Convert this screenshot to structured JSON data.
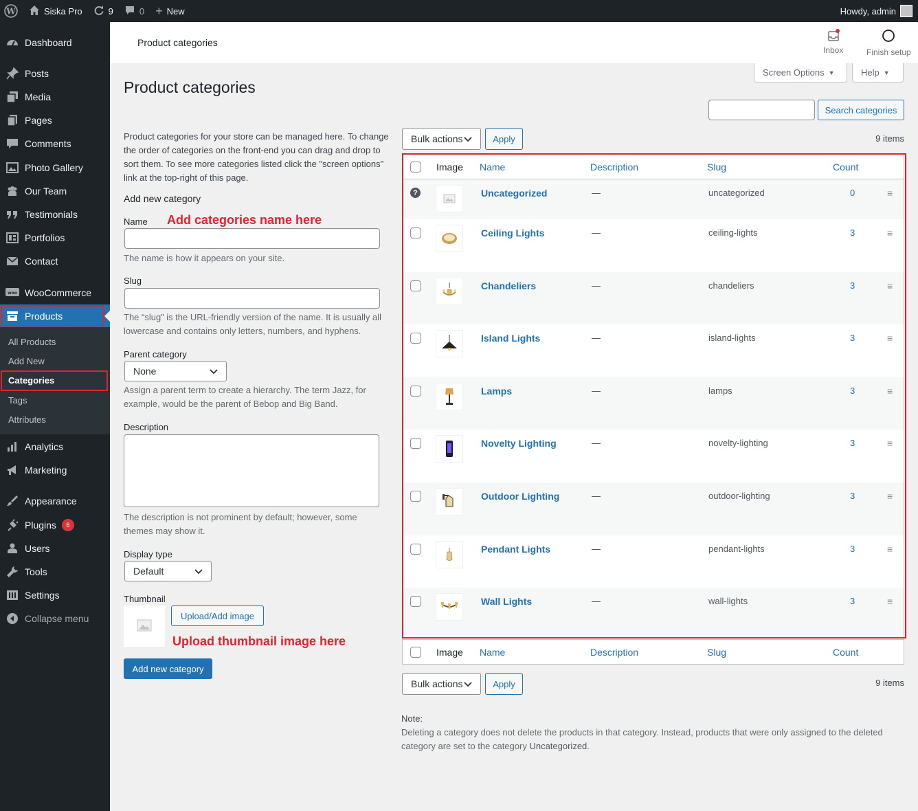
{
  "adminbar": {
    "site_name": "Siska Pro",
    "updates_count": "9",
    "comments_count": "0",
    "new_label": "New",
    "howdy": "Howdy, admin"
  },
  "sidebar": {
    "items": [
      {
        "label": "Dashboard",
        "icon": "dashboard-icon"
      },
      {
        "label": "Posts",
        "icon": "pin-icon"
      },
      {
        "label": "Media",
        "icon": "media-icon"
      },
      {
        "label": "Pages",
        "icon": "pages-icon"
      },
      {
        "label": "Comments",
        "icon": "comment-icon"
      },
      {
        "label": "Photo Gallery",
        "icon": "gallery-icon"
      },
      {
        "label": "Our Team",
        "icon": "team-icon"
      },
      {
        "label": "Testimonials",
        "icon": "quote-icon"
      },
      {
        "label": "Portfolios",
        "icon": "portfolio-icon"
      },
      {
        "label": "Contact",
        "icon": "mail-icon"
      },
      {
        "label": "WooCommerce",
        "icon": "woo-icon"
      },
      {
        "label": "Products",
        "icon": "archive-icon"
      },
      {
        "label": "Analytics",
        "icon": "chart-icon"
      },
      {
        "label": "Marketing",
        "icon": "megaphone-icon"
      },
      {
        "label": "Appearance",
        "icon": "brush-icon"
      },
      {
        "label": "Plugins",
        "icon": "plugin-icon",
        "badge": "6"
      },
      {
        "label": "Users",
        "icon": "user-icon"
      },
      {
        "label": "Tools",
        "icon": "wrench-icon"
      },
      {
        "label": "Settings",
        "icon": "settings-icon"
      },
      {
        "label": "Collapse menu",
        "icon": "collapse-icon"
      }
    ],
    "submenu": [
      "All Products",
      "Add New",
      "Categories",
      "Tags",
      "Attributes"
    ]
  },
  "header": {
    "title": "Product categories",
    "inbox_label": "Inbox",
    "finish_label": "Finish setup"
  },
  "screen_options": {
    "screen_options_label": "Screen Options",
    "help_label": "Help"
  },
  "page_title": "Product categories",
  "search": {
    "button_label": "Search categories",
    "value": ""
  },
  "form": {
    "intro": "Product categories for your store can be managed here. To change the order of categories on the front-end you can drag and drop to sort them. To see more categories listed click the \"screen options\" link at the top-right of this page.",
    "heading": "Add new category",
    "name_label": "Name",
    "name_annotation": "Add categories name here",
    "name_help": "The name is how it appears on your site.",
    "slug_label": "Slug",
    "slug_help": "The “slug” is the URL-friendly version of the name. It is usually all lowercase and contains only letters, numbers, and hyphens.",
    "parent_label": "Parent category",
    "parent_value": "None",
    "parent_help": "Assign a parent term to create a hierarchy. The term Jazz, for example, would be the parent of Bebop and Big Band.",
    "description_label": "Description",
    "description_help": "The description is not prominent by default; however, some themes may show it.",
    "display_type_label": "Display type",
    "display_type_value": "Default",
    "thumbnail_label": "Thumbnail",
    "upload_button": "Upload/Add image",
    "thumbnail_annotation": "Upload thumbnail image here",
    "submit_button": "Add new category"
  },
  "bulk": {
    "label": "Bulk actions",
    "apply": "Apply",
    "items_count": "9 items"
  },
  "table": {
    "columns": {
      "image": "Image",
      "name": "Name",
      "description": "Description",
      "slug": "Slug",
      "count": "Count"
    },
    "rows": [
      {
        "name": "Uncategorized",
        "description": "—",
        "slug": "uncategorized",
        "count": "0",
        "thumb": "placeholder-icon"
      },
      {
        "name": "Ceiling Lights",
        "description": "—",
        "slug": "ceiling-lights",
        "count": "3",
        "thumb": "ceiling-light-icon"
      },
      {
        "name": "Chandeliers",
        "description": "—",
        "slug": "chandeliers",
        "count": "3",
        "thumb": "chandelier-icon"
      },
      {
        "name": "Island Lights",
        "description": "—",
        "slug": "island-lights",
        "count": "3",
        "thumb": "island-light-icon"
      },
      {
        "name": "Lamps",
        "description": "—",
        "slug": "lamps",
        "count": "3",
        "thumb": "lamp-icon"
      },
      {
        "name": "Novelty Lighting",
        "description": "—",
        "slug": "novelty-lighting",
        "count": "3",
        "thumb": "novelty-light-icon"
      },
      {
        "name": "Outdoor Lighting",
        "description": "—",
        "slug": "outdoor-lighting",
        "count": "3",
        "thumb": "outdoor-light-icon"
      },
      {
        "name": "Pendant Lights",
        "description": "—",
        "slug": "pendant-lights",
        "count": "3",
        "thumb": "pendant-light-icon"
      },
      {
        "name": "Wall Lights",
        "description": "—",
        "slug": "wall-lights",
        "count": "3",
        "thumb": "wall-light-icon"
      }
    ]
  },
  "note": {
    "title": "Note:",
    "text": "Deleting a category does not delete the products in that category. Instead, products that were only assigned to the deleted category are set to the category",
    "emphasis": "Uncategorized",
    "end": "."
  },
  "colors": {
    "accent": "#2271b1",
    "annotation": "#e0242d",
    "sidebar": "#1d2327"
  }
}
